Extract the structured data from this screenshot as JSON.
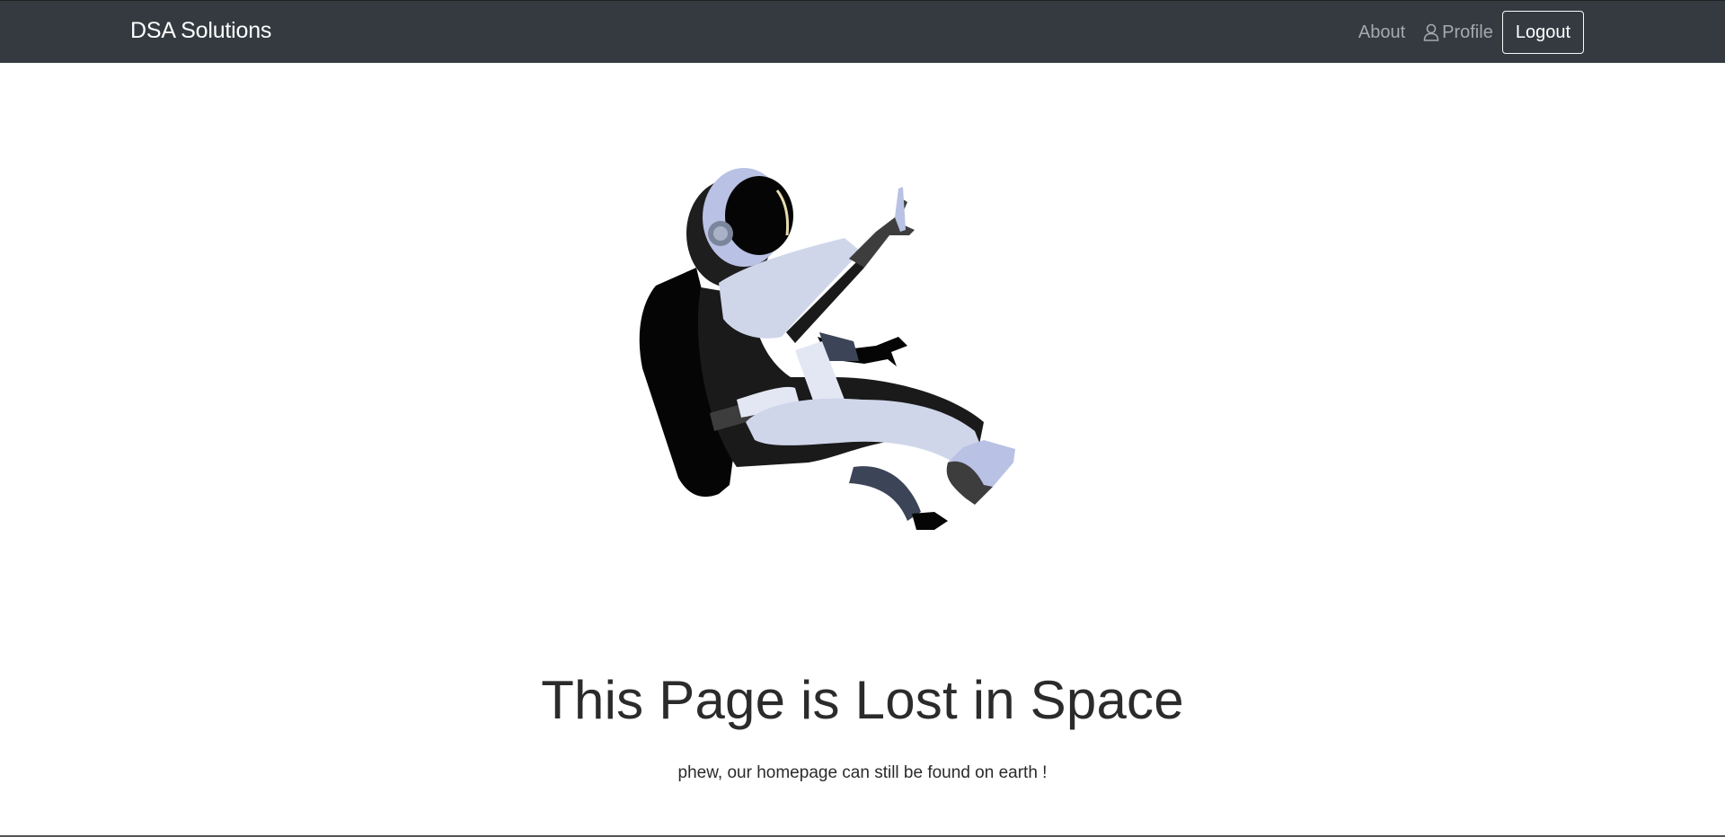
{
  "navbar": {
    "brand": "DSA Solutions",
    "links": [
      {
        "label": "About",
        "icon": null
      },
      {
        "label": "Profile",
        "icon": "user-icon"
      }
    ],
    "logout_label": "Logout",
    "background": "#343a40"
  },
  "hero": {
    "image": "astronaut-illustration",
    "title": "This Page is Lost in Space",
    "subtitle": "phew, our homepage can still be found on earth !"
  }
}
